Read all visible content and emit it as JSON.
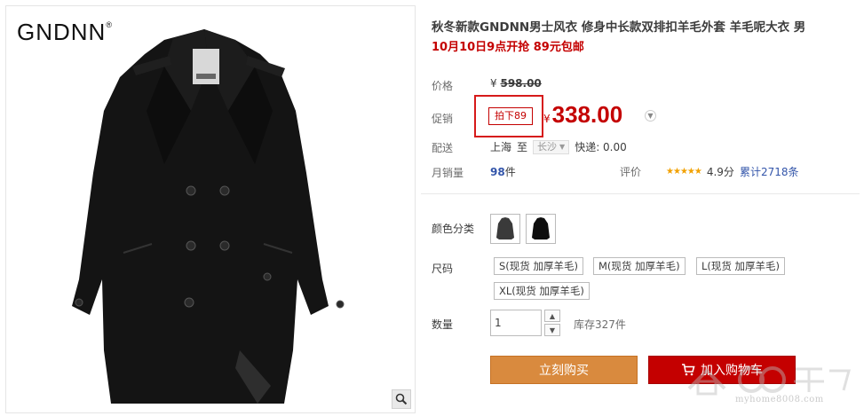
{
  "brand": {
    "logo_text": "GNDNN",
    "registered_mark": "®"
  },
  "product": {
    "title": "秋冬新款GNDNN男士风衣 修身中长款双排扣羊毛外套 羊毛呢大衣 男",
    "subtitle": "10月10日9点开抢 89元包邮"
  },
  "price": {
    "label": "价格",
    "currency": "¥",
    "original": "598.00"
  },
  "promo": {
    "label": "促销",
    "badge": "拍下89",
    "currency": "¥",
    "price": "338.00"
  },
  "shipping": {
    "label": "配送",
    "from": "上海",
    "to_word": "至",
    "to_city": "长沙",
    "express": "快递: 0.00"
  },
  "sales": {
    "label": "月销量",
    "count": "98",
    "unit": "件"
  },
  "rating": {
    "label": "评价",
    "stars": "★★★★★",
    "score": "4.9分",
    "reviews": "累计2718条"
  },
  "color": {
    "label": "颜色分类",
    "options": [
      "dark-grey-coat",
      "black-coat"
    ]
  },
  "size": {
    "label": "尺码",
    "options": [
      "S(现货 加厚羊毛)",
      "M(现货 加厚羊毛)",
      "L(现货 加厚羊毛)",
      "XL(现货 加厚羊毛)"
    ]
  },
  "quantity": {
    "label": "数量",
    "value": "1",
    "stock": "库存327件"
  },
  "actions": {
    "buy_now": "立刻购买",
    "add_cart": "加入购物车"
  },
  "watermark": {
    "url": "myhome8008.com"
  },
  "colors": {
    "accent_red": "#c40000",
    "buy_orange": "#d98a3e",
    "link_blue": "#3355aa",
    "star_gold": "#f2a100"
  },
  "icons": [
    "zoom-icon",
    "chevron-down-icon",
    "cart-icon",
    "arrow-up-icon",
    "arrow-down-icon"
  ]
}
